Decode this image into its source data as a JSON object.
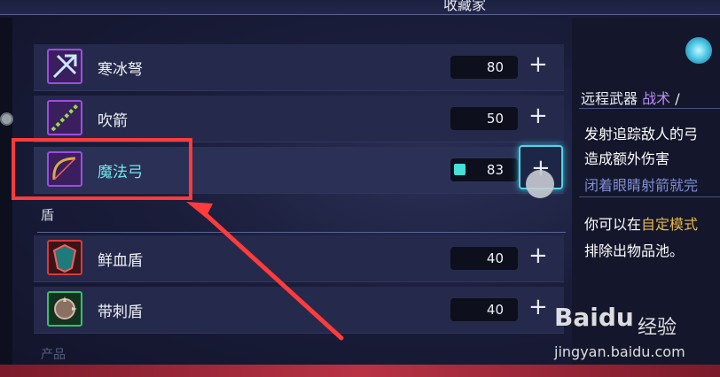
{
  "window": {
    "title": "收藏家"
  },
  "items": [
    {
      "name": "寒冰弩",
      "count": "80",
      "plus": "+",
      "icon": "crossbow-icon",
      "selected": false
    },
    {
      "name": "吹箭",
      "count": "50",
      "plus": "+",
      "icon": "blowgun-icon",
      "selected": false
    },
    {
      "name": "魔法弓",
      "count": "83",
      "plus": "+",
      "icon": "magic-bow-icon",
      "selected": true,
      "gem": "cell-icon"
    }
  ],
  "section": {
    "title": "盾"
  },
  "shields": [
    {
      "name": "鲜血盾",
      "count": "40",
      "plus": "+",
      "icon": "blood-shield-icon"
    },
    {
      "name": "带刺盾",
      "count": "40",
      "plus": "+",
      "icon": "spiked-shield-icon"
    }
  ],
  "next_section_faded": "产品",
  "details": {
    "category": "远程武器",
    "tag": "战术",
    "slash": "/",
    "line1": "发射追踪敌人的弓",
    "line2": "造成额外伤害",
    "hint": "闭着眼睛射箭就完",
    "line3_prefix": "你可以在",
    "line3_highlight": "自定模式",
    "line4": "排除出物品池。"
  },
  "watermark": {
    "brand": "Baidu",
    "product": "经验",
    "url": "jingyan.baidu.com"
  },
  "colors": {
    "accent": "#4fd6e6",
    "highlight_box": "#ff3b3b",
    "tag": "#b88cf5",
    "hint": "#7f8fd6",
    "gold": "#e8b84a"
  }
}
